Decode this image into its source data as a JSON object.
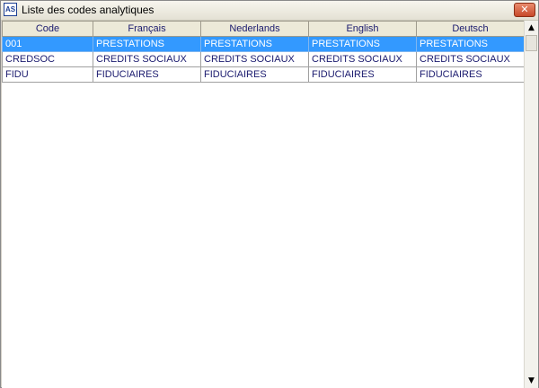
{
  "window": {
    "title": "Liste des codes analytiques",
    "icon_text": "AS",
    "close_glyph": "✕"
  },
  "table": {
    "columns": [
      "Code",
      "Français",
      "Nederlands",
      "English",
      "Deutsch"
    ],
    "rows": [
      [
        "001",
        "PRESTATIONS",
        "PRESTATIONS",
        "PRESTATIONS",
        "PRESTATIONS"
      ],
      [
        "CREDSOC",
        "CREDITS SOCIAUX",
        "CREDITS SOCIAUX",
        "CREDITS SOCIAUX",
        "CREDITS SOCIAUX"
      ],
      [
        "FIDU",
        "FIDUCIAIRES",
        "FIDUCIAIRES",
        "FIDUCIAIRES",
        "FIDUCIAIRES"
      ]
    ],
    "selected_row": 0
  },
  "scrollbar": {
    "up_glyph": "▲",
    "down_glyph": "▼"
  },
  "colors": {
    "selection": "#3399ff",
    "text": "#1a1a6e"
  }
}
